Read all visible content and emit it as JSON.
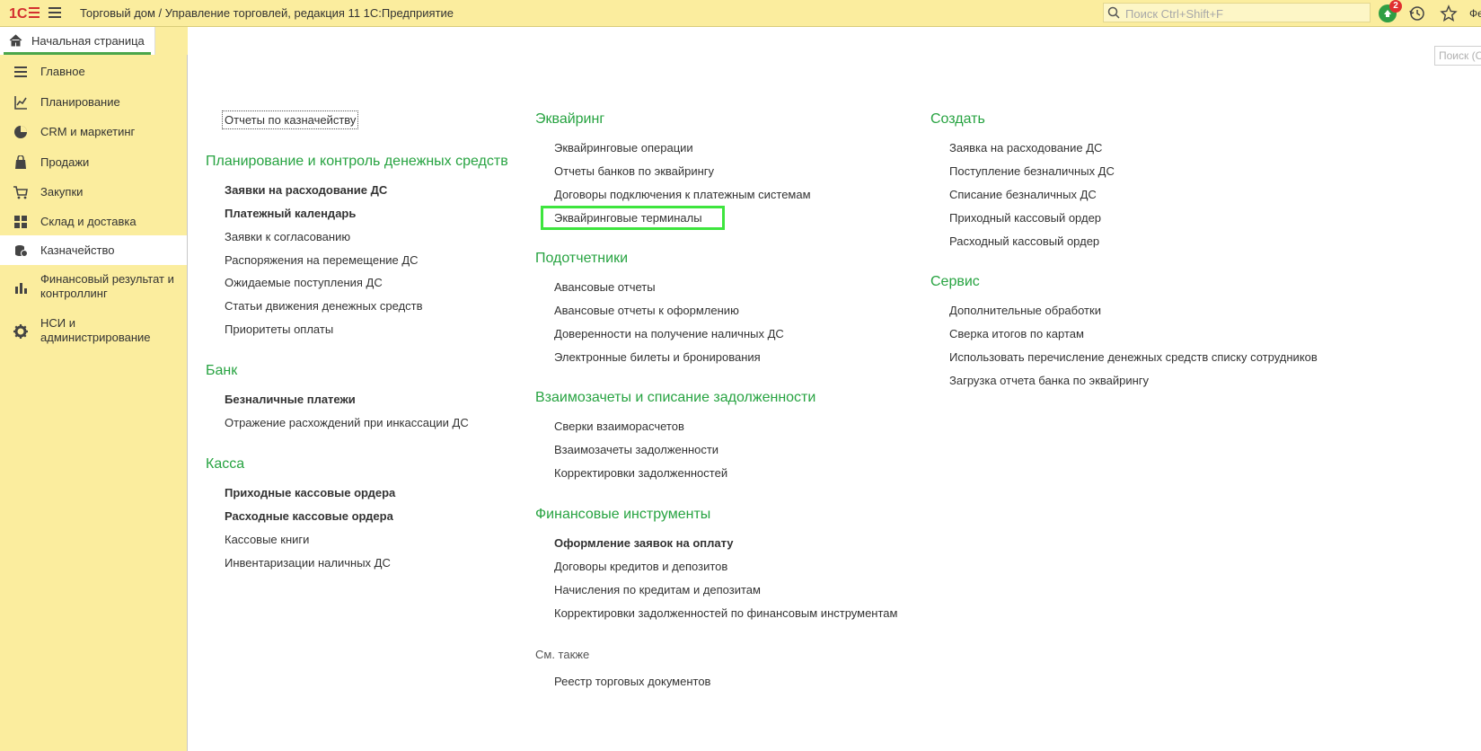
{
  "topbar": {
    "logo": "1С",
    "title": "Торговый дом / Управление торговлей, редакция 11 1С:Предприятие",
    "search_placeholder": "Поиск Ctrl+Shift+F",
    "notification_count": "2",
    "user_clip": "Фе",
    "icons": [
      "menu-icon",
      "search-icon",
      "bell-icon",
      "history-icon",
      "star-icon"
    ]
  },
  "tab": {
    "home_label": "Начальная страница"
  },
  "sidebar": {
    "items": [
      {
        "label": "Главное",
        "icon": "list-icon"
      },
      {
        "label": "Планирование",
        "icon": "planning-icon"
      },
      {
        "label": "CRM и маркетинг",
        "icon": "pie-chart-icon"
      },
      {
        "label": "Продажи",
        "icon": "bag-icon"
      },
      {
        "label": "Закупки",
        "icon": "cart-icon"
      },
      {
        "label": "Склад и доставка",
        "icon": "warehouse-grid-icon"
      },
      {
        "label": "Казначейство",
        "icon": "coins-icon",
        "active": true
      },
      {
        "label": "Финансовый результат и контроллинг",
        "icon": "bar-chart-icon"
      },
      {
        "label": "НСИ и администрирование",
        "icon": "gear-icon"
      }
    ]
  },
  "content": {
    "search_placeholder": "Поиск (Ctrl+F)",
    "col1": {
      "top_link": "Отчеты по казначейству",
      "groups": [
        {
          "title": "Планирование и контроль денежных средств",
          "links": [
            {
              "label": "Заявки на расходование ДС",
              "bold": true
            },
            {
              "label": "Платежный календарь",
              "bold": true
            },
            {
              "label": "Заявки к согласованию"
            },
            {
              "label": "Распоряжения на перемещение ДС"
            },
            {
              "label": "Ожидаемые поступления ДС"
            },
            {
              "label": "Статьи движения денежных средств"
            },
            {
              "label": "Приоритеты оплаты"
            }
          ]
        },
        {
          "title": "Банк",
          "links": [
            {
              "label": "Безналичные платежи",
              "bold": true
            },
            {
              "label": "Отражение расхождений при инкассации ДС"
            }
          ]
        },
        {
          "title": "Касса",
          "links": [
            {
              "label": "Приходные кассовые ордера",
              "bold": true
            },
            {
              "label": "Расходные кассовые ордера",
              "bold": true
            },
            {
              "label": "Кассовые книги"
            },
            {
              "label": "Инвентаризации наличных ДС"
            }
          ]
        }
      ]
    },
    "col2": {
      "groups": [
        {
          "title": "Эквайринг",
          "links": [
            {
              "label": "Эквайринговые операции"
            },
            {
              "label": "Отчеты банков по эквайрингу"
            },
            {
              "label": "Договоры подключения к платежным системам"
            },
            {
              "label": "Эквайринговые терминалы",
              "highlighted": true
            }
          ]
        },
        {
          "title": "Подотчетники",
          "links": [
            {
              "label": "Авансовые отчеты"
            },
            {
              "label": "Авансовые отчеты к оформлению"
            },
            {
              "label": "Доверенности на получение наличных ДС"
            },
            {
              "label": "Электронные билеты и бронирования"
            }
          ]
        },
        {
          "title": "Взаимозачеты и списание задолженности",
          "links": [
            {
              "label": "Сверки взаиморасчетов"
            },
            {
              "label": "Взаимозачеты задолженности"
            },
            {
              "label": "Корректировки задолженностей"
            }
          ]
        },
        {
          "title": "Финансовые инструменты",
          "links": [
            {
              "label": "Оформление заявок на оплату",
              "bold": true
            },
            {
              "label": "Договоры кредитов и депозитов"
            },
            {
              "label": "Начисления по кредитам и депозитам"
            },
            {
              "label": "Корректировки задолженностей по финансовым инструментам"
            }
          ]
        }
      ],
      "see_also_title": "См. также",
      "see_also_links": [
        {
          "label": "Реестр торговых документов"
        }
      ]
    },
    "col3": {
      "groups": [
        {
          "title": "Создать",
          "links": [
            {
              "label": "Заявка на расходование ДС"
            },
            {
              "label": "Поступление безналичных ДС"
            },
            {
              "label": "Списание безналичных ДС"
            },
            {
              "label": "Приходный кассовый ордер"
            },
            {
              "label": "Расходный кассовый ордер"
            }
          ]
        },
        {
          "title": "Сервис",
          "links": [
            {
              "label": "Дополнительные обработки"
            },
            {
              "label": "Сверка итогов по картам"
            },
            {
              "label": "Использовать перечисление денежных средств списку сотрудников"
            },
            {
              "label": "Загрузка отчета банка по эквайрингу"
            }
          ]
        }
      ]
    },
    "highlight_color": "#3ee53e",
    "group_title_color": "#27a341"
  }
}
